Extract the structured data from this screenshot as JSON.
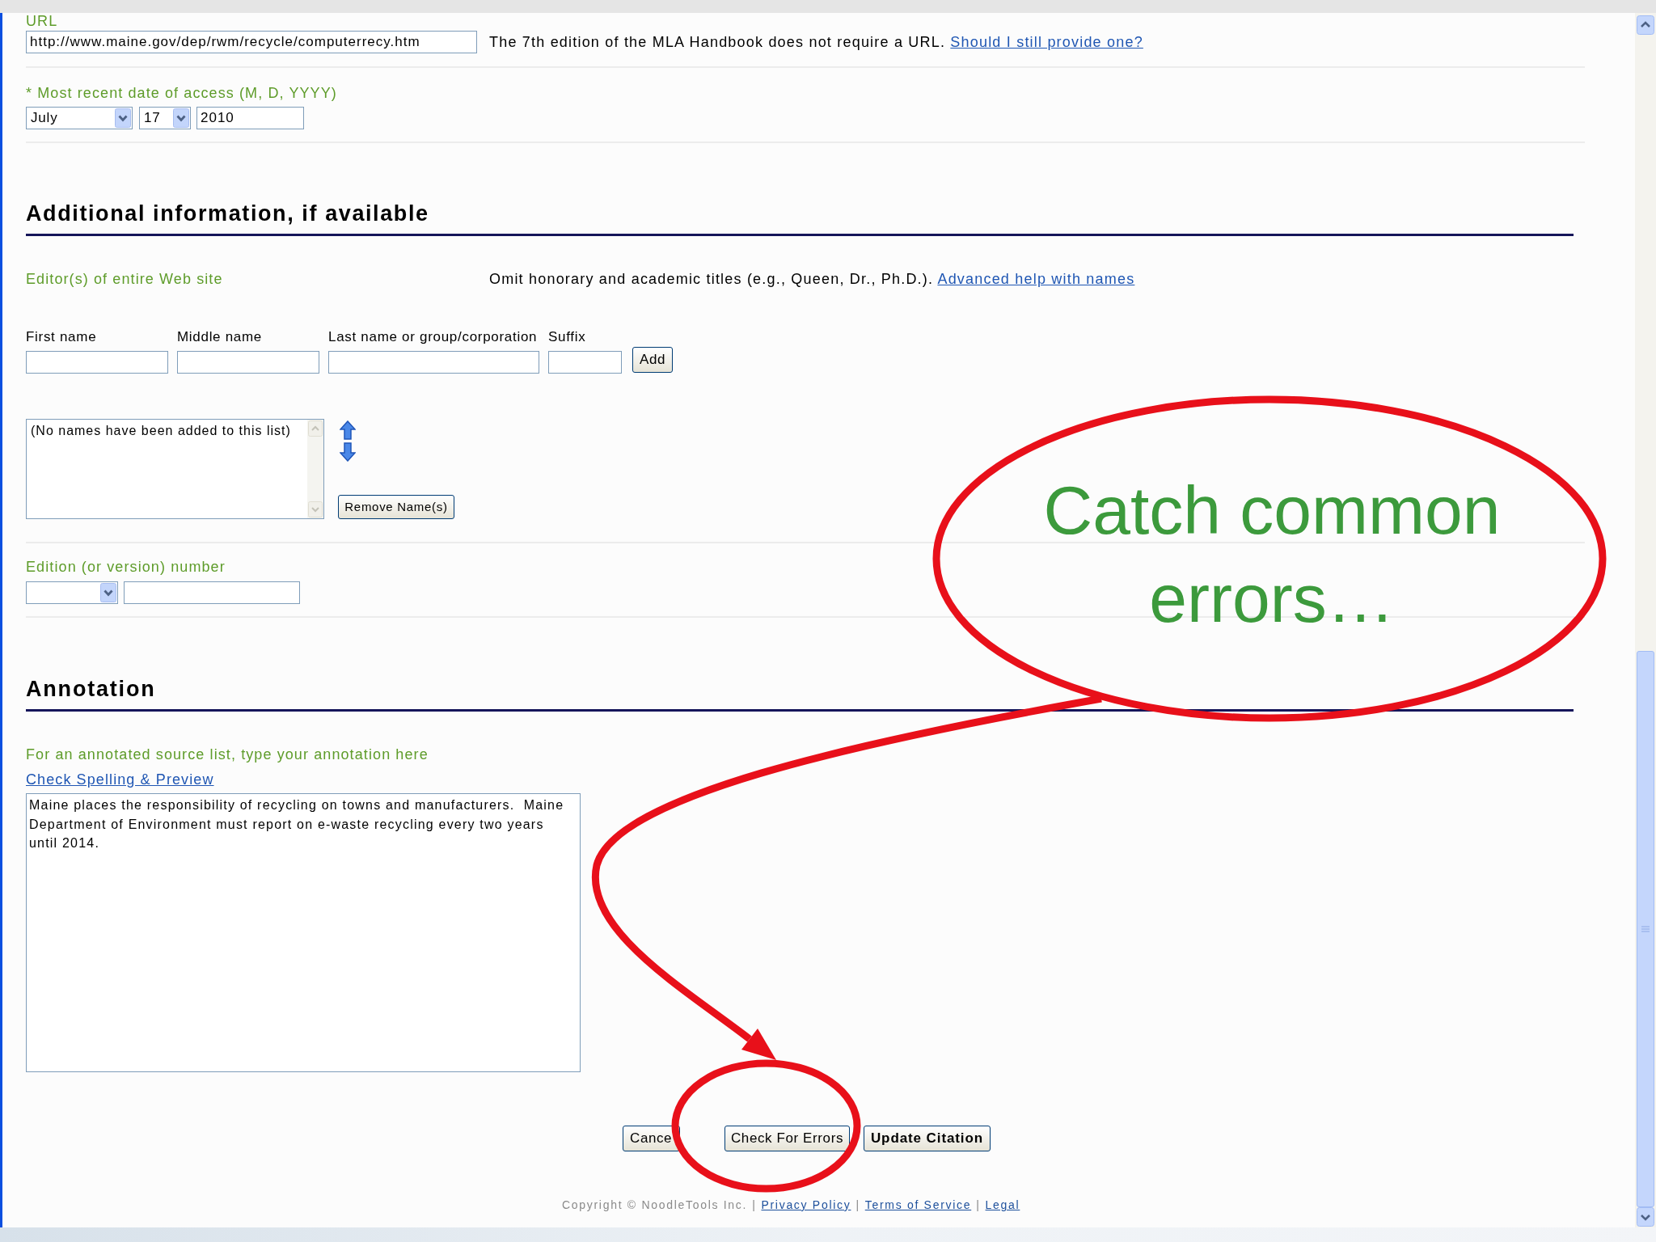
{
  "url_field": {
    "label": "URL",
    "value": "http://www.maine.gov/dep/rwm/recycle/computerrecy.htm",
    "note": "The 7th edition of the MLA Handbook does not require a URL.",
    "help_link": "Should I still provide one?"
  },
  "access_date": {
    "label": "* Most recent date of access (M, D, YYYY)",
    "month": "July",
    "day": "17",
    "year": "2010"
  },
  "additional_info": {
    "heading": "Additional information, if available",
    "editors": {
      "label": "Editor(s) of entire Web site",
      "note": "Omit honorary and academic titles (e.g., Queen, Dr., Ph.D.).",
      "help_link": "Advanced help with names",
      "name_fields": [
        {
          "label": "First name"
        },
        {
          "label": "Middle name"
        },
        {
          "label": "Last name or group/corporation"
        },
        {
          "label": "Suffix"
        }
      ],
      "add_button": "Add",
      "names_list": [
        "(No names have been added to this list)"
      ],
      "remove_button": "Remove Name(s)"
    },
    "edition": {
      "label": "Edition (or version) number"
    }
  },
  "annotation": {
    "heading": "Annotation",
    "label": "For an annotated source list, type your annotation here",
    "spell_check_link": "Check Spelling & Preview",
    "value": "Maine places the responsibility of recycling on towns and manufacturers.  Maine Department of Environment must report on e-waste recycling every two years until 2014."
  },
  "buttons": [
    {
      "label": "Cance",
      "kind": "normal"
    },
    {
      "label": "Check For Errors",
      "kind": "normal"
    },
    {
      "label": "Update Citation",
      "kind": "default"
    }
  ],
  "footer": [
    {
      "kind": "text",
      "text": "Copyright © NoodleTools Inc."
    },
    {
      "kind": "separator",
      "text": "|"
    },
    {
      "kind": "link",
      "text": "Privacy Policy"
    },
    {
      "kind": "separator",
      "text": "|"
    },
    {
      "kind": "link",
      "text": "Terms of Service"
    },
    {
      "kind": "separator",
      "text": "|"
    },
    {
      "kind": "link",
      "text": "Legal"
    }
  ],
  "callout": {
    "text": "Catch common errors…"
  }
}
